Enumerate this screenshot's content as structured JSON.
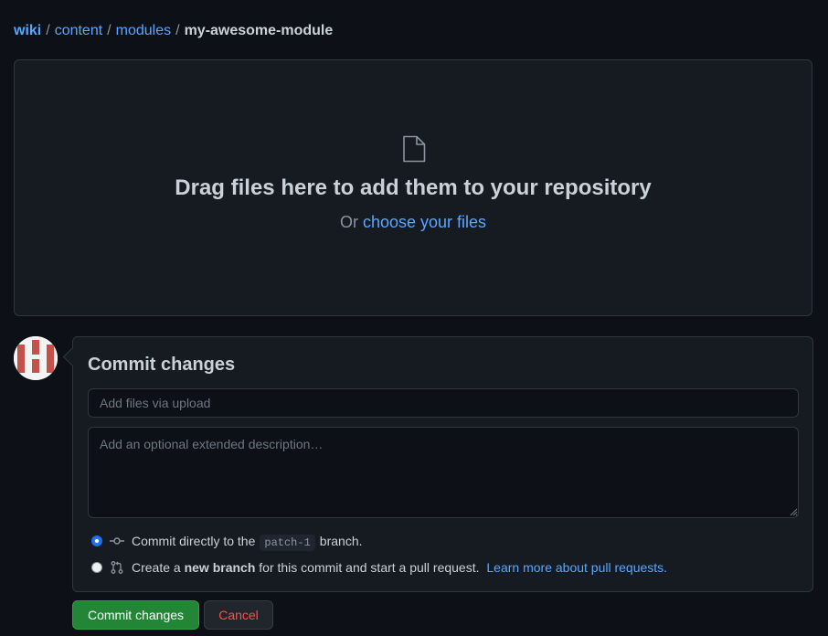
{
  "breadcrumb": {
    "items": [
      "wiki",
      "content",
      "modules"
    ],
    "current": "my-awesome-module",
    "separator": "/"
  },
  "dropzone": {
    "icon": "file-icon",
    "title": "Drag files here to add them to your repository",
    "prefix": "Or",
    "choose_link": "choose your files"
  },
  "commit": {
    "title": "Commit changes",
    "summary_placeholder": "Add files via upload",
    "description_placeholder": "Add an optional extended description…",
    "option_direct": {
      "selected": true,
      "icon": "git-commit-icon",
      "text_before": "Commit directly to the",
      "branch": "patch-1",
      "text_after": "branch."
    },
    "option_new_branch": {
      "selected": false,
      "icon": "git-pull-request-icon",
      "text_before": "Create a",
      "bold": "new branch",
      "text_after": "for this commit and start a pull request.",
      "link": "Learn more about pull requests."
    }
  },
  "buttons": {
    "commit_label": "Commit changes",
    "cancel_label": "Cancel"
  },
  "colors": {
    "background": "#0d1117",
    "link": "#58a6ff",
    "primary_button": "#238636",
    "danger_text": "#f85149",
    "avatar_accent": "#c5524a"
  }
}
